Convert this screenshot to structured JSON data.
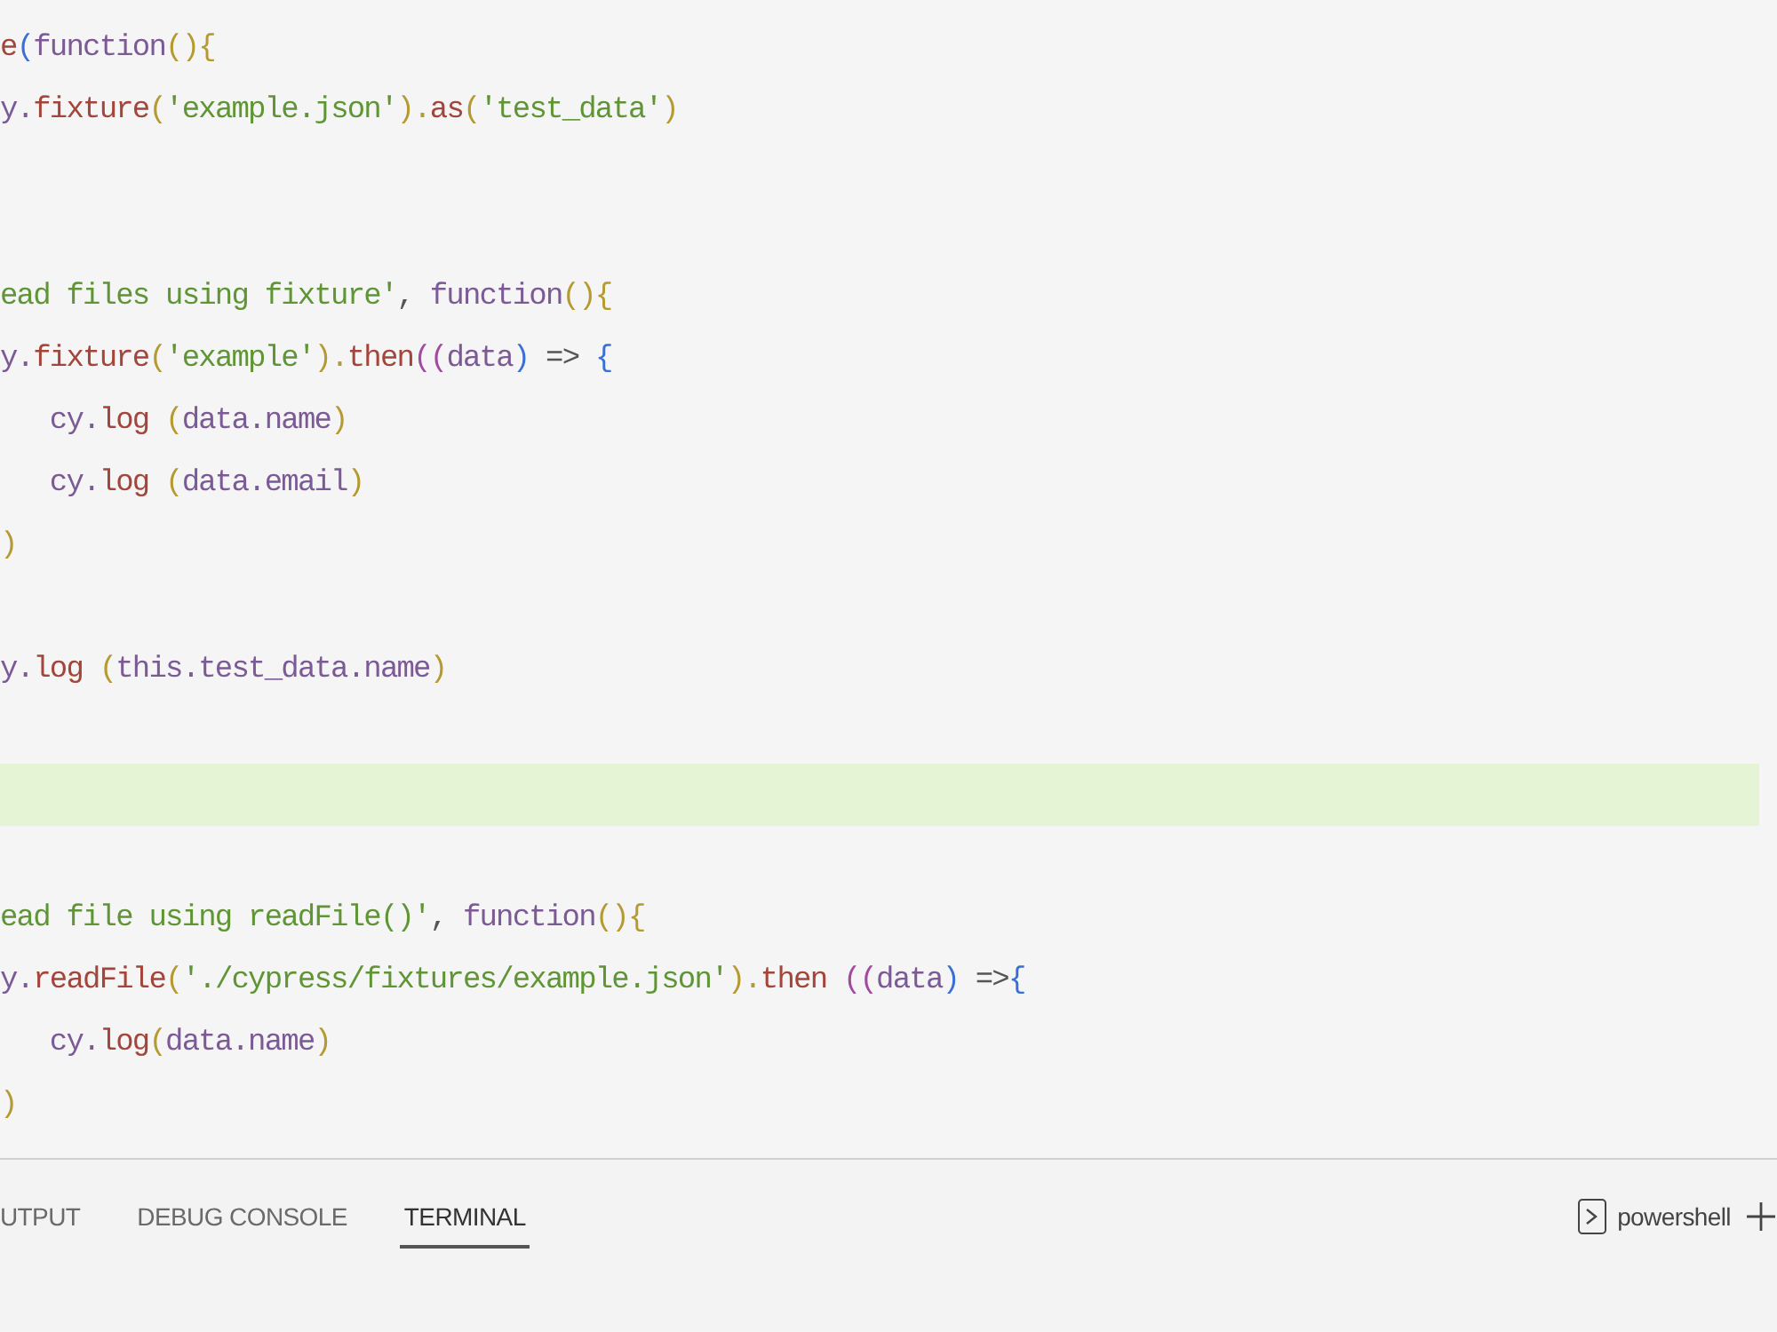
{
  "editor": {
    "lines": [
      {
        "kind": "code",
        "highlighted": false,
        "tokens": [
          {
            "kind": "method",
            "text": "e"
          },
          {
            "kind": "bracket3",
            "text": "("
          },
          {
            "kind": "keyword",
            "text": "function"
          },
          {
            "kind": "bracket1",
            "text": "(){"
          }
        ]
      },
      {
        "kind": "code",
        "highlighted": false,
        "tokens": [
          {
            "kind": "plain",
            "text": "y."
          },
          {
            "kind": "method",
            "text": "fixture"
          },
          {
            "kind": "bracket1",
            "text": "("
          },
          {
            "kind": "string",
            "text": "'example.json'"
          },
          {
            "kind": "bracket1",
            "text": ")."
          },
          {
            "kind": "method",
            "text": "as"
          },
          {
            "kind": "bracket1",
            "text": "("
          },
          {
            "kind": "string",
            "text": "'test_data'"
          },
          {
            "kind": "bracket1",
            "text": ")"
          }
        ]
      },
      {
        "kind": "blank"
      },
      {
        "kind": "blank"
      },
      {
        "kind": "code",
        "highlighted": false,
        "tokens": [
          {
            "kind": "string",
            "text": "ead files using fixture'"
          },
          {
            "kind": "punct",
            "text": ", "
          },
          {
            "kind": "keyword",
            "text": "function"
          },
          {
            "kind": "bracket1",
            "text": "(){"
          }
        ]
      },
      {
        "kind": "code",
        "highlighted": false,
        "tokens": [
          {
            "kind": "plain",
            "text": "y."
          },
          {
            "kind": "method",
            "text": "fixture"
          },
          {
            "kind": "bracket1",
            "text": "("
          },
          {
            "kind": "string",
            "text": "'example'"
          },
          {
            "kind": "bracket1",
            "text": ")."
          },
          {
            "kind": "method",
            "text": "then"
          },
          {
            "kind": "bracket2",
            "text": "(("
          },
          {
            "kind": "keyword",
            "text": "data"
          },
          {
            "kind": "bracket3",
            "text": ")"
          },
          {
            "kind": "punct",
            "text": " => "
          },
          {
            "kind": "bracket3",
            "text": "{"
          }
        ]
      },
      {
        "kind": "code",
        "highlighted": false,
        "tokens": [
          {
            "kind": "plain",
            "text": "   cy."
          },
          {
            "kind": "method",
            "text": "log"
          },
          {
            "kind": "bracket1",
            "text": " ("
          },
          {
            "kind": "keyword",
            "text": "data.name"
          },
          {
            "kind": "bracket1",
            "text": ")"
          }
        ]
      },
      {
        "kind": "code",
        "highlighted": false,
        "tokens": [
          {
            "kind": "plain",
            "text": "   cy."
          },
          {
            "kind": "method",
            "text": "log"
          },
          {
            "kind": "bracket1",
            "text": " ("
          },
          {
            "kind": "keyword",
            "text": "data.email"
          },
          {
            "kind": "bracket1",
            "text": ")"
          }
        ]
      },
      {
        "kind": "code",
        "highlighted": false,
        "tokens": [
          {
            "kind": "bracket1",
            "text": ")"
          }
        ]
      },
      {
        "kind": "blank"
      },
      {
        "kind": "code",
        "highlighted": false,
        "tokens": [
          {
            "kind": "plain",
            "text": "y."
          },
          {
            "kind": "method",
            "text": "log"
          },
          {
            "kind": "bracket1",
            "text": " ("
          },
          {
            "kind": "keyword",
            "text": "this.test_data.name"
          },
          {
            "kind": "bracket1",
            "text": ")"
          }
        ]
      },
      {
        "kind": "blank"
      },
      {
        "kind": "blank",
        "highlighted": true
      },
      {
        "kind": "blank"
      },
      {
        "kind": "code",
        "highlighted": false,
        "tokens": [
          {
            "kind": "string",
            "text": "ead file using readFile()'"
          },
          {
            "kind": "punct",
            "text": ", "
          },
          {
            "kind": "keyword",
            "text": "function"
          },
          {
            "kind": "bracket1",
            "text": "(){"
          }
        ]
      },
      {
        "kind": "code",
        "highlighted": false,
        "tokens": [
          {
            "kind": "plain",
            "text": "y."
          },
          {
            "kind": "method",
            "text": "readFile"
          },
          {
            "kind": "bracket1",
            "text": "("
          },
          {
            "kind": "string",
            "text": "'./cypress/fixtures/example.json'"
          },
          {
            "kind": "bracket1",
            "text": ")."
          },
          {
            "kind": "method",
            "text": "then"
          },
          {
            "kind": "bracket2",
            "text": " (("
          },
          {
            "kind": "keyword",
            "text": "data"
          },
          {
            "kind": "bracket3",
            "text": ")"
          },
          {
            "kind": "punct",
            "text": " =>"
          },
          {
            "kind": "bracket3",
            "text": "{"
          }
        ]
      },
      {
        "kind": "code",
        "highlighted": false,
        "tokens": [
          {
            "kind": "plain",
            "text": "   cy."
          },
          {
            "kind": "method",
            "text": "log"
          },
          {
            "kind": "bracket1",
            "text": "("
          },
          {
            "kind": "keyword",
            "text": "data.name"
          },
          {
            "kind": "bracket1",
            "text": ")"
          }
        ]
      },
      {
        "kind": "code",
        "highlighted": false,
        "tokens": [
          {
            "kind": "bracket1",
            "text": ")"
          }
        ]
      }
    ]
  },
  "panel": {
    "tabs": [
      {
        "label": "UTPUT",
        "selected": false
      },
      {
        "label": "DEBUG CONSOLE",
        "selected": false
      },
      {
        "label": "TERMINAL",
        "selected": true
      }
    ],
    "terminal": {
      "name": "powershell"
    }
  }
}
